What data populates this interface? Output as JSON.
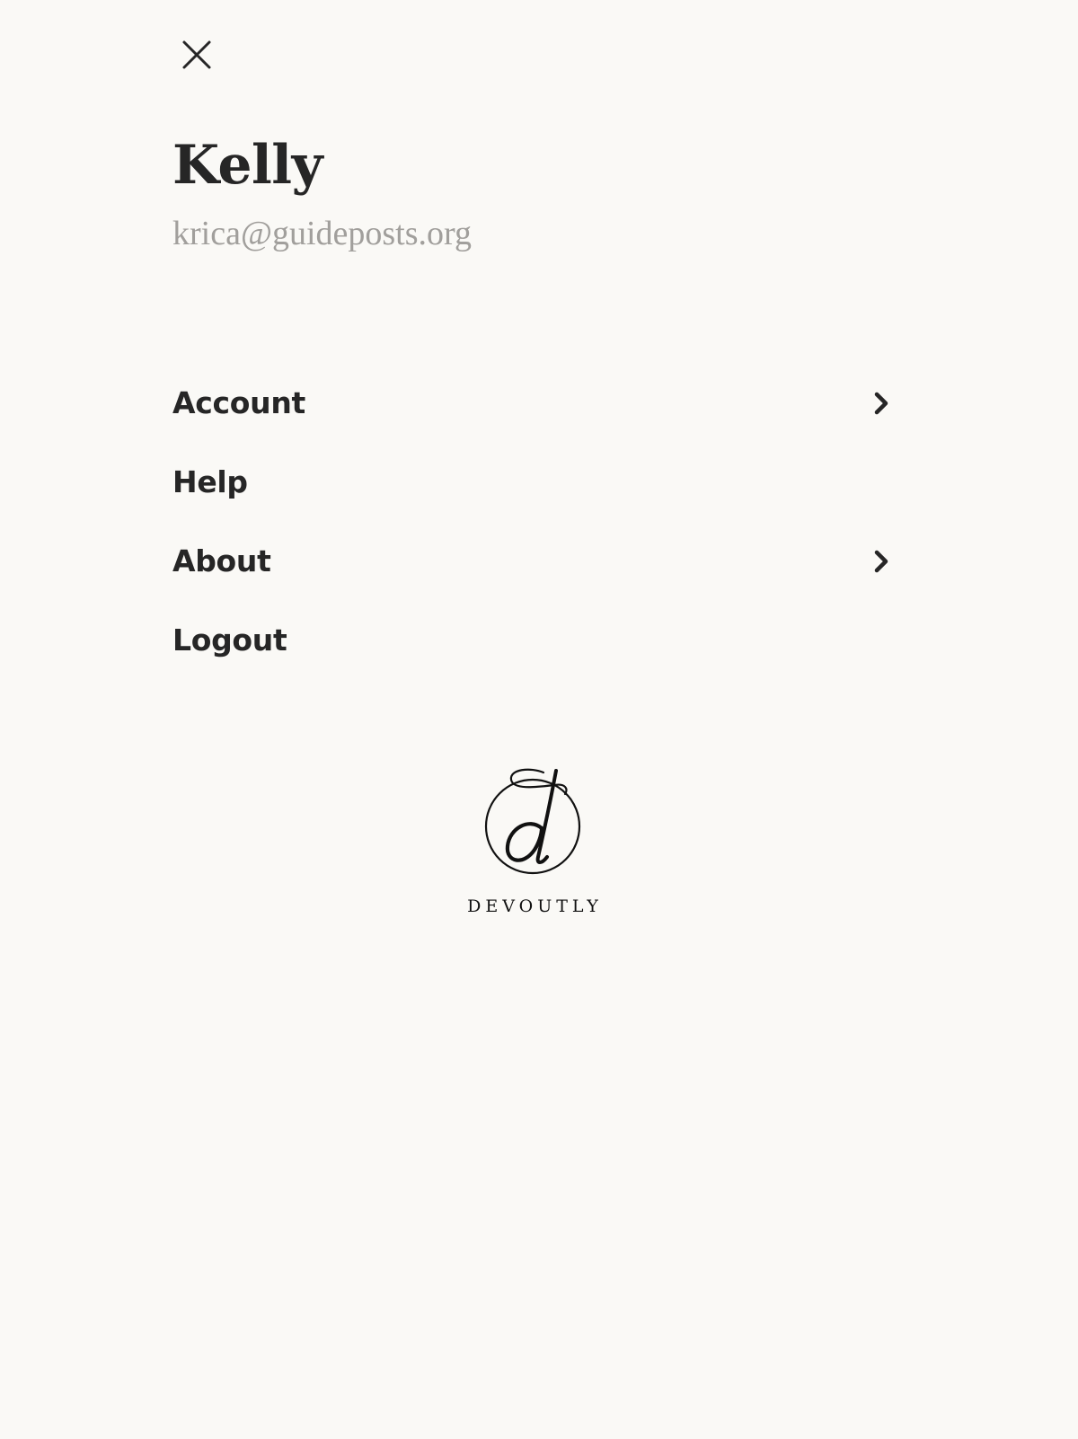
{
  "header": {
    "close_icon": "close-icon"
  },
  "user": {
    "name": "Kelly",
    "email": "krica@guideposts.org"
  },
  "menu": {
    "items": [
      {
        "label": "Account",
        "has_chevron": true,
        "icon": "chevron-right-icon"
      },
      {
        "label": "Help",
        "has_chevron": false
      },
      {
        "label": "About",
        "has_chevron": true,
        "icon": "chevron-right-icon"
      },
      {
        "label": "Logout",
        "has_chevron": false
      }
    ]
  },
  "brand": {
    "name": "DEVOUTLY",
    "logo_icon": "devoutly-logo-icon"
  },
  "colors": {
    "background": "#faf9f6",
    "text": "#262626",
    "muted_text": "#a19f9c"
  }
}
